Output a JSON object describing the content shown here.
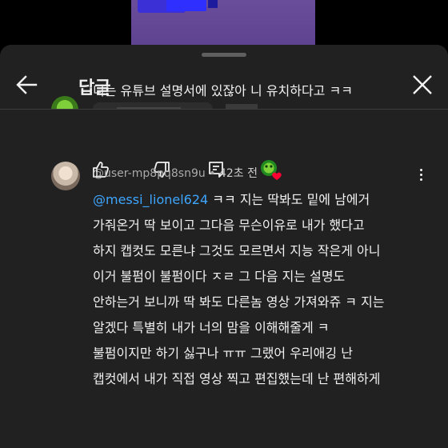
{
  "header": {
    "title": "답글"
  },
  "comment1": {
    "text": "니는 유튜브 설명서에 있잖아 니 유치하다고 ㅋㅋ"
  },
  "comment2": {
    "author": "@user-mp8pq8sn9u",
    "separator": " • ",
    "time": "42초 전",
    "mention": "@messi_lionel624",
    "first_line_rest": "  ㅋㅋ 지는 딱봐도 밑에 남에거",
    "lines": [
      "가줘온거 딱 보이고 그다음 무슨이유로  내가 했다고",
      "하지 캡컷도 모른냐 그것도 모르면서 지능 작은게 아니",
      "이거 불펌이 불펌이다 ㅈㄹ 그 다음 지는 설명도",
      "안하는거 보니까 딱 봐도 다른놈 영상 가져와쥬 ㅋ 지는",
      "알겠다 특별히 내가 너의 맘을 이해해줄게 ㅋ",
      "불펌이지만 하기 싫구나 ㅠㅠ 그랬어 우리애깅 난",
      "캡컷에서 내가 직접 영상 찍고 편집했는데 난 편해하게"
    ]
  },
  "icons": {
    "back": "arrow-left-icon",
    "close": "close-icon",
    "like": "thumb-up-icon",
    "dislike": "thumb-down-icon",
    "reply": "reply-comment-icon",
    "creator_heart": "creator-heart-avatar-icon",
    "more": "more-vertical-icon"
  },
  "colors": {
    "accent_link": "#3ea6ff",
    "heart": "#ff0033",
    "sheet_bg": "#212121"
  }
}
